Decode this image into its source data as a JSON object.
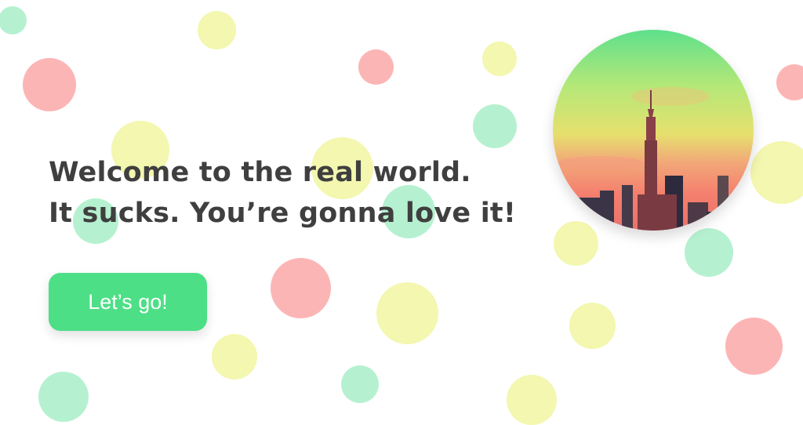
{
  "hero": {
    "headline_line1": "Welcome to the real world.",
    "headline_line2": "It sucks. You’re gonna love it!",
    "cta_label": "Let’s go!"
  },
  "colors": {
    "accent": "#4ddf86",
    "text": "#3f3f3f",
    "dot_red": "#fa7878",
    "dot_yellow": "#eaf06e",
    "dot_green": "#5ae096"
  },
  "illustration": {
    "subject": "city skyline at sunset with tall spire tower",
    "icon": "skyline-image"
  }
}
